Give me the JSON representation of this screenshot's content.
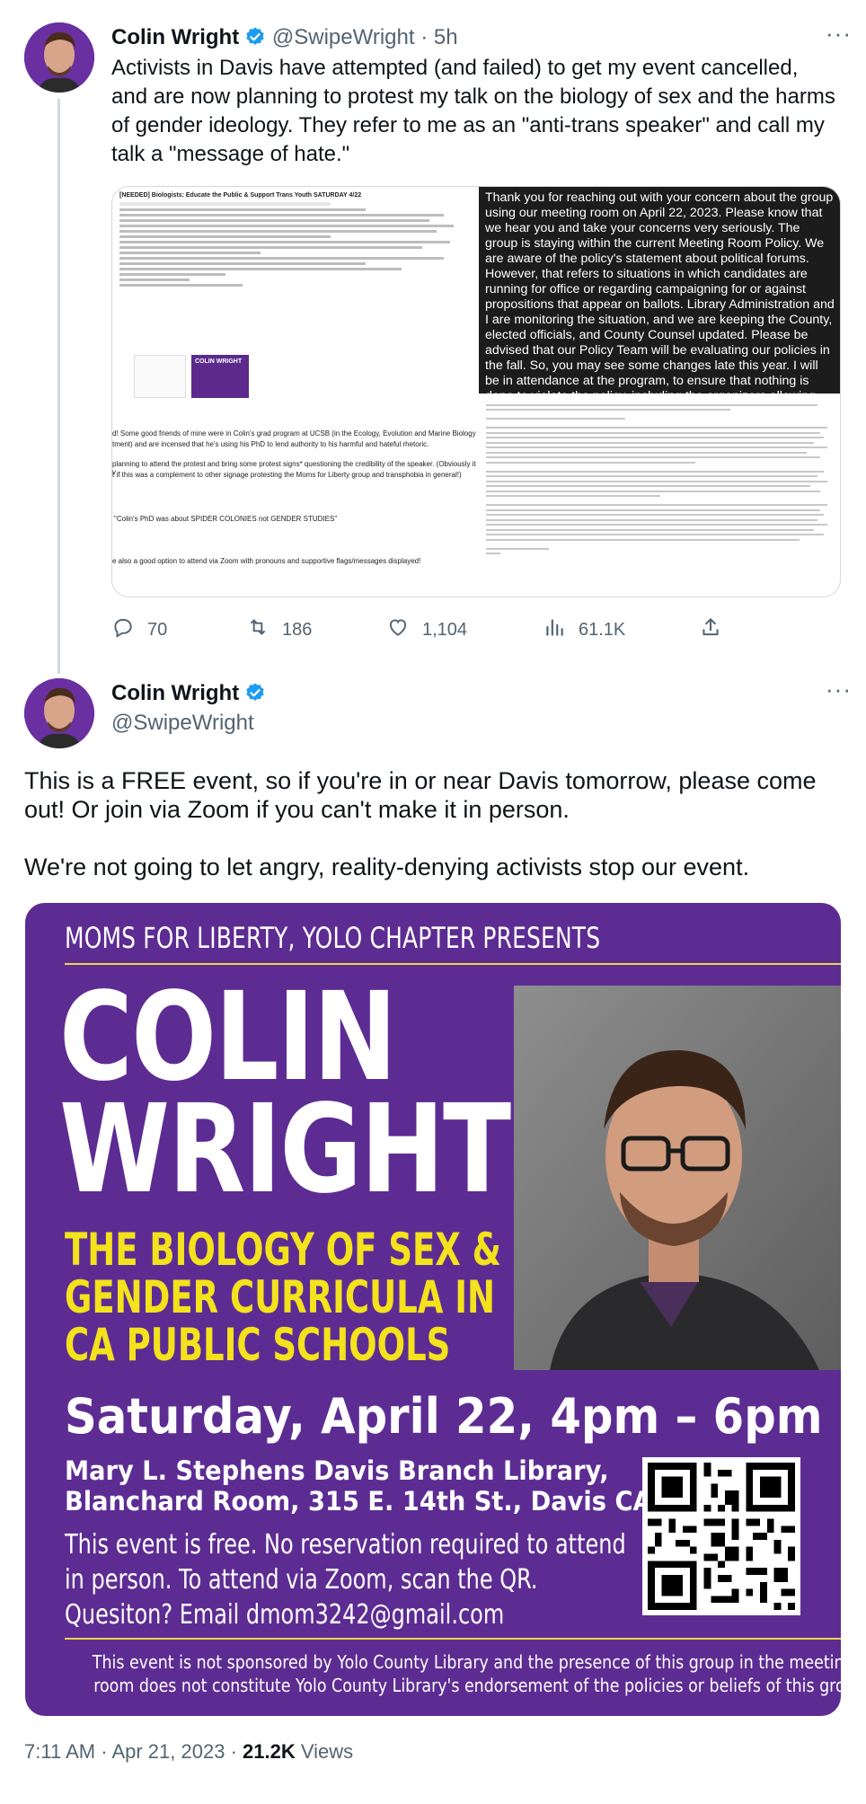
{
  "tweet1": {
    "author_name": "Colin Wright",
    "handle": "@SwipeWright",
    "separator": "·",
    "time": "5h",
    "more": "···",
    "text": "Activists in Davis have attempted (and failed) to get my event cancelled, and are now planning to protest my talk on the biology of sex and the harms of gender ideology. They refer to me as an \"anti-trans speaker\" and call my talk a \"message of hate.\"",
    "media": {
      "email_subject": "[NEEDED] Biologists: Educate the Public & Support Trans Youth SATURDAY 4/22",
      "thumb_title": "COLIN WRIGHT",
      "email_lines": [
        "d! Some good friends of mine were in Colin's grad program at UCSB (in the Ecology, Evolution and Marine Biology",
        "tment) and are incensed that he's using his PhD to lend authority to his harmful and hateful rhetoric.",
        "planning to attend the protest and bring some protest signs* questioning the credibility of the speaker. (Obviously it v",
        "t if this was a complement to other signage protesting the Moms for Liberty group and transphobia in general!)",
        "\"Colin's PhD was about SPIDER COLONIES not GENDER STUDIES\"",
        "e also a good option to attend via Zoom with pronouns and supportive flags/messages displayed!"
      ],
      "library_reply": "Thank you for reaching out with your concern about the group using our meeting room on April 22, 2023. Please know that we hear you and take your concerns very seriously. The group is staying within the current Meeting Room Policy. We are aware of the policy's statement about political forums. However, that refers to situations in which candidates are running for office or regarding campaigning for or against propositions that appear on ballots. Library Administration and I are monitoring the situation, and we are keeping the County, elected officials, and County Counsel updated. Please be advised that our Policy Team will be evaluating our policies in the fall. So, you may see some changes late this year. I will be in attendance at the program, to ensure that nothing is done to violate the policy, including the organizers allowing dissenting"
    },
    "stats": {
      "replies": "70",
      "retweets": "186",
      "likes": "1,104",
      "views": "61.1K"
    }
  },
  "tweet2": {
    "author_name": "Colin Wright",
    "handle": "@SwipeWright",
    "more": "···",
    "paragraph1": "This is a FREE event, so if you're in or near Davis tomorrow, please come out! Or join via Zoom if you can't make it in person.",
    "paragraph2": "We're not going to let angry, reality-denying activists stop our event.",
    "poster": {
      "header": "MOMS FOR LIBERTY, YOLO CHAPTER PRESENTS",
      "name_line1": "COLIN",
      "name_line2": "WRIGHT",
      "topic_line1": "THE BIOLOGY OF SEX &",
      "topic_line2": "GENDER CURRICULA IN",
      "topic_line3": "CA PUBLIC SCHOOLS",
      "date": "Saturday, April 22, 4pm – 6pm",
      "venue_line1": "Mary L. Stephens Davis Branch Library,",
      "venue_line2": "Blanchard Room, 315 E. 14th St., Davis CA",
      "info_line1": "This event is free. No reservation required to attend",
      "info_line2": "in person. To attend via Zoom, scan the QR.",
      "info_line3": "Quesiton? Email dmom3242@gmail.com",
      "disclaimer_line1": "This event is not sponsored by Yolo County Library and the presence of this group in the meeting",
      "disclaimer_line2": "room does not constitute Yolo County Library's endorsement of the policies or beliefs of this group.",
      "colors": {
        "background": "#5d2c93",
        "accent": "#f3e21c"
      }
    },
    "footer": {
      "time": "7:11 AM",
      "separator": "·",
      "date": "Apr 21, 2023",
      "views_count": "21.2K",
      "views_label": "Views"
    }
  },
  "colors": {
    "verified": "#1d9bf0",
    "secondary_text": "#536471"
  }
}
